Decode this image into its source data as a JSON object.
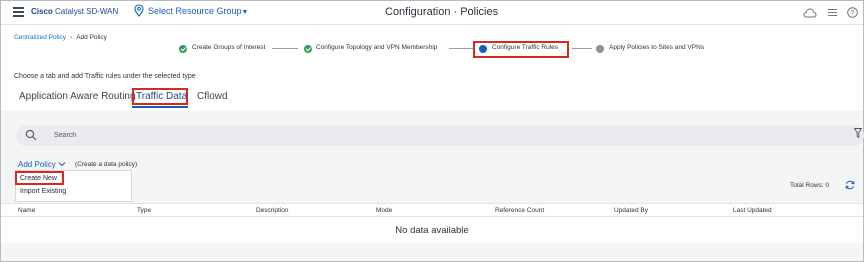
{
  "header": {
    "brand_bold": "Cisco",
    "brand_rest": "Catalyst SD-WAN",
    "resource_group": "Select Resource Group",
    "title": "Configuration · Policies",
    "icons": [
      "hamburger-menu-icon",
      "location-pin-icon",
      "cloud-icon",
      "list-icon",
      "help-icon"
    ]
  },
  "breadcrumb": {
    "parent": "Centralized Policy",
    "current": "Add Policy"
  },
  "stepper": {
    "steps": [
      {
        "label": "Create Groups of Interest",
        "status": "done"
      },
      {
        "label": "Configure Topology and VPN Membership",
        "status": "done"
      },
      {
        "label": "Configure Traffic Rules",
        "status": "current"
      },
      {
        "label": "Apply Policies to Sites and VPNs",
        "status": "pending"
      }
    ]
  },
  "instructions": "Choose a tab and add Traffic rules under the selected type",
  "tabs": [
    {
      "label": "Application Aware Routing",
      "active": false
    },
    {
      "label": "Traffic Data",
      "active": true
    },
    {
      "label": "Cflowd",
      "active": false
    }
  ],
  "search": {
    "placeholder": "Search",
    "value": ""
  },
  "add_policy": {
    "label": "Add Policy",
    "hint": "(Create a data policy)",
    "menu": [
      "Create New",
      "Import Existing"
    ]
  },
  "table": {
    "total_rows_label": "Total Rows: 0",
    "columns": [
      "Name",
      "Type",
      "Description",
      "Mode",
      "Reference Count",
      "Updated By",
      "Last Updated"
    ],
    "empty_message": "No data available"
  },
  "colors": {
    "accent": "#1a5fb4",
    "highlight": "#d42b1e",
    "done": "#2f9e5a"
  }
}
